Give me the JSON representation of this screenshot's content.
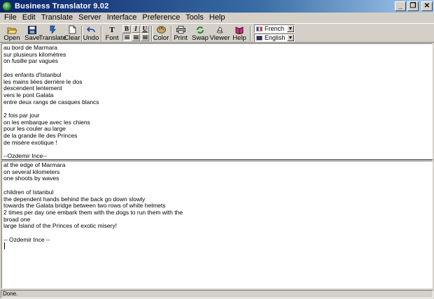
{
  "window": {
    "title": "Business Translator 9.02",
    "minimize_glyph": "_",
    "restore_glyph": "❐",
    "close_glyph": "✕"
  },
  "menu": [
    "File",
    "Edit",
    "Translate",
    "Server",
    "Interface",
    "Preference",
    "Tools",
    "Help"
  ],
  "toolbar": {
    "open": "Open",
    "save": "Save",
    "translate": "Translate",
    "clear": "Clear",
    "undo": "Undo",
    "font": "Font",
    "bold": "B",
    "italic": "I",
    "underline": "U",
    "color": "Color",
    "print": "Print",
    "swap": "Swap",
    "viewer": "Viewer",
    "help": "Help"
  },
  "languages": {
    "source": "French",
    "target": "English"
  },
  "source_text": "au bord de Marmara\nsur plusieurs kilomètres\non fusille par vagues\n\ndes enfants d'Istanbul\nles mains liées derrière le dos\ndescendent lentement\nvers le pont Galata\nentre deux rangs de casques blancs\n\n2 fois par jour\non les embarque avec les chiens\npour les couler au large\nde la grande Ile des Princes\nde misère exotique !\n\n--Ozdemir Ince--",
  "target_text": "at the edge of Marmara\non several kilometers\none shoots by waves\n\nchildren of Istanbul\nthe dependent hands behind the back go down slowly\ntowards the Galata bridge between two rows of white helmets\n2 times per day one embark them with the dogs to run them with the\nbroad one\nlarge Island of the Princes of exotic misery!\n\n-- Ozdemir Ince --",
  "status": "Done.",
  "colors": {
    "titlebar_start": "#0a246a",
    "titlebar_end": "#a6caf0",
    "chrome": "#d4d0c8"
  },
  "icons": {
    "open": "folder-open-icon",
    "save": "floppy-disk-icon",
    "translate": "translate-icon",
    "clear": "clear-page-icon",
    "undo": "undo-arrow-icon",
    "font": "font-icon",
    "color": "palette-icon",
    "print": "printer-icon",
    "swap": "swap-arrows-icon",
    "viewer": "viewer-icon",
    "help": "help-book-icon"
  }
}
